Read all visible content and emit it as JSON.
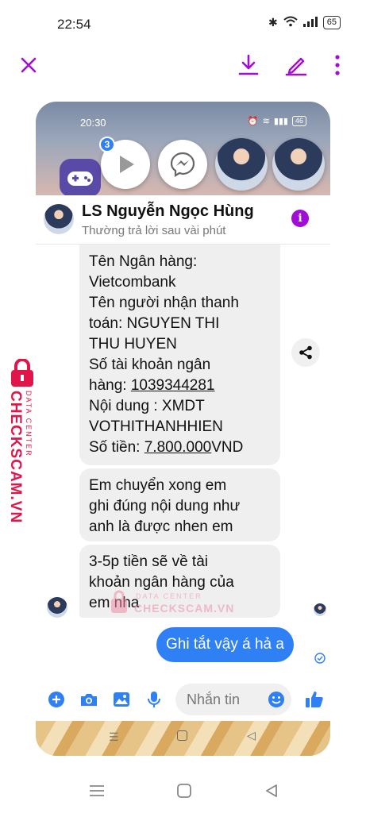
{
  "status_bar": {
    "time": "22:54",
    "battery": "65"
  },
  "inner_status": {
    "time": "20:30",
    "battery": "46"
  },
  "bubbles": {
    "badge_count": "3"
  },
  "chat": {
    "contact_name": "LS Nguyễn Ngọc Hùng",
    "subtitle": "Thường trả lời sau vài phút",
    "message1": {
      "line1": "Tên Ngân hàng:",
      "line2": "Vietcombank",
      "line3": "Tên người nhận thanh",
      "line4": "toán: NGUYEN THI",
      "line5": "THU HUYEN",
      "line6": "Số tài khoản ngân",
      "line7_prefix": "hàng: ",
      "account_number": "1039344281",
      "line8": "Nội dung : XMDT",
      "line9": "VOTHITHANHHIEN",
      "amount_prefix": "Số tiền: ",
      "amount": "7.800.000",
      "amount_suffix": "VND"
    },
    "message2": {
      "line1": "Em chuyển xong em",
      "line2": "ghi đúng nội dung như",
      "line3": "anh là được nhen em"
    },
    "message3": {
      "line1": "3-5p tiền sẽ về tài",
      "line2": "khoản ngân hàng của",
      "line3": "em nha"
    },
    "reply": "Ghi tắt vậy á hả a",
    "composer_placeholder": "Nhắn tin"
  },
  "watermark": {
    "side_small": "DATA CENTER",
    "side_big": "CHECKSCAM.VN",
    "center_small": "DATA CENTER",
    "center_big": "CHECKSCAM.VN"
  },
  "colors": {
    "accent": "#a10cd6",
    "messenger_blue": "#2f7ff5",
    "watermark": "#e0154a"
  }
}
